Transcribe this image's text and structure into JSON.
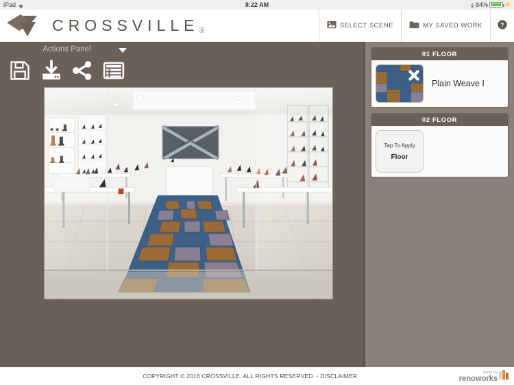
{
  "status_bar": {
    "carrier": "iPad",
    "wifi_icon": "wifi-icon",
    "time": "8:22 AM",
    "bluetooth_icon": "bluetooth-icon",
    "battery_percent": "84%",
    "battery_icon": "battery-charging-icon"
  },
  "header": {
    "brand": "CROSSVILLE",
    "brand_registered": "®",
    "logo_icon": "crossville-diamond-logo",
    "actions": [
      {
        "label": "SELECT SCENE",
        "icon": "image-icon"
      },
      {
        "label": "MY SAVED WORK",
        "icon": "folder-icon"
      }
    ],
    "help": {
      "label": "?",
      "icon": "help-circle-icon"
    }
  },
  "actions_panel": {
    "title": "Actions Panel",
    "caret_icon": "chevron-down-icon",
    "buttons": [
      {
        "name": "save",
        "icon": "floppy-save-icon"
      },
      {
        "name": "download",
        "icon": "download-icon"
      },
      {
        "name": "share",
        "icon": "share-nodes-icon"
      },
      {
        "name": "list",
        "icon": "list-view-icon"
      }
    ]
  },
  "stage": {
    "scene_name": "shoe-store-interior-scene",
    "alt": "Retail shoe store interior with tiled floor runner"
  },
  "layers": [
    {
      "title": "01 FLOOR",
      "product_name": "Plain Weave I",
      "has_swatch": true,
      "remove_icon": "close-x-icon",
      "swatch_colors": [
        "#3d6186",
        "#9b6a36",
        "#8b8093"
      ]
    },
    {
      "title": "02 FLOOR",
      "placeholder_top": "Tap To Apply",
      "placeholder_bottom": "Floor",
      "has_swatch": false
    }
  ],
  "footer": {
    "copyright": "COPYRIGHT © 2016 CROSSVILLE. ALL RIGHTS RESERVED. - DISCLAIMER",
    "attribution_small": "made by",
    "attribution_name": "renoworks",
    "attribution_icon": "renoworks-bars-icon"
  },
  "colors": {
    "app_background": "#6b6058",
    "rail_background": "#8a8078",
    "brand_text": "#595144",
    "tile_blue": "#3d6186",
    "tile_wood": "#9b6a36",
    "tile_mauve": "#8b8093"
  }
}
